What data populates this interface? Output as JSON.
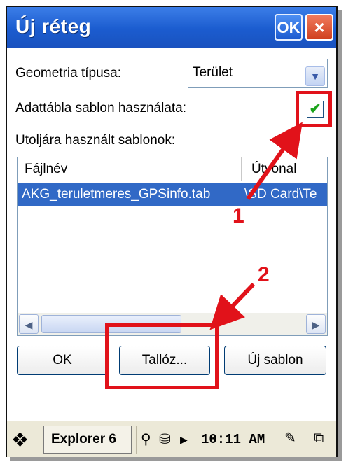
{
  "window": {
    "title": "Új réteg",
    "ok_label": "OK",
    "close_label": "×"
  },
  "form": {
    "geometry_label": "Geometria típusa:",
    "geometry_value": "Terület",
    "template_label": "Adattábla sablon használata:",
    "template_checked": true,
    "recent_label": "Utoljára használt sablonok:"
  },
  "list": {
    "columns": [
      "Fájlnév",
      "Útvonal"
    ],
    "rows": [
      {
        "file": "AKG_teruletmeres_GPSinfo.tab",
        "path": "\\SD Card\\Te"
      }
    ]
  },
  "buttons": {
    "ok": "OK",
    "browse": "Tallóz...",
    "new_template": "Új sablon"
  },
  "annotations": {
    "marker1": "1",
    "marker2": "2",
    "color": "#e1121a"
  },
  "taskbar": {
    "app": "Explorer 6",
    "time": "10:11 AM"
  }
}
